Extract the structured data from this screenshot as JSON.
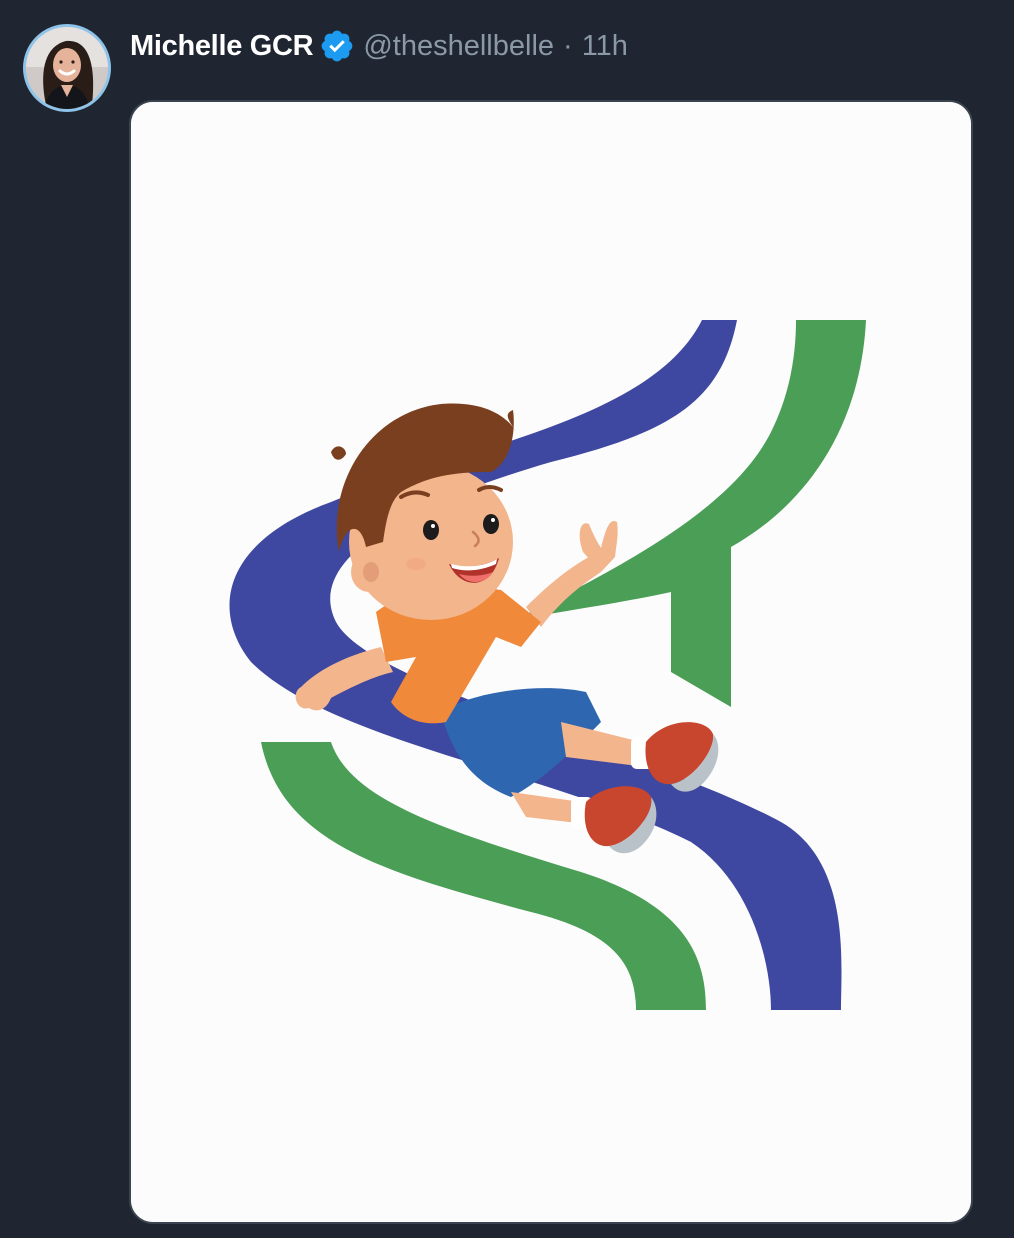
{
  "post": {
    "author": {
      "display_name": "Michelle GCR",
      "handle": "@theshellbelle",
      "verified": true,
      "avatar_icon": "profile-photo"
    },
    "separator": "·",
    "timestamp": "11h",
    "media": {
      "kind": "illustration",
      "icon": "boy-on-slide-logo"
    }
  },
  "colors": {
    "background": "#1f2631",
    "name_text": "#ffffff",
    "muted_text": "#8b98a5",
    "verified_badge": "#1d9bf0",
    "avatar_ring": "#8fc4ea",
    "slide_blue": "#3f48a0",
    "slide_green": "#4a9e56",
    "shirt_orange": "#f08a3a",
    "shorts_blue": "#2f66b0",
    "hair_brown": "#7a3f1f",
    "shoe_red": "#c8452e"
  }
}
